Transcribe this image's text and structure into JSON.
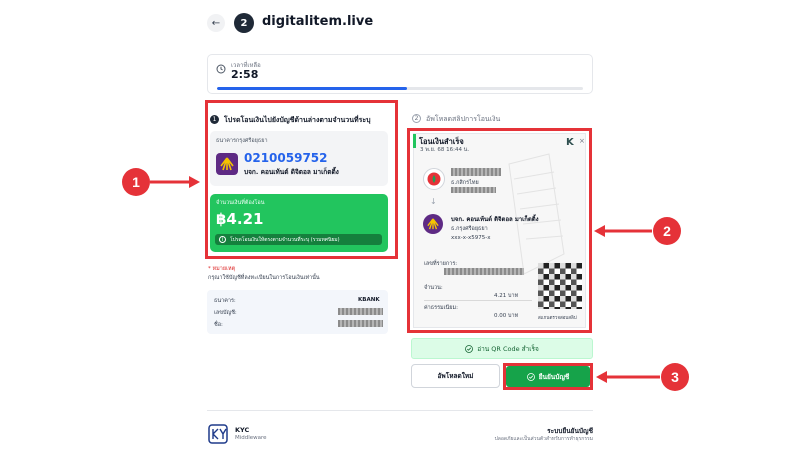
{
  "header": {
    "back_icon": "←",
    "step_number": "2",
    "site": "digitalitem.live"
  },
  "timer": {
    "label": "เวลาที่เหลือ",
    "value": "2:58",
    "progress_fraction": 0.52,
    "accent": "#2563eb"
  },
  "step1": {
    "number": "1",
    "title": "โปรดโอนเงินไปยังบัญชีด้านล่างตามจำนวนที่ระบุ",
    "bank_name": "ธนาคารกรุงศรีอยุธยา",
    "account_number": "0210059752",
    "account_name": "บจก. คอนเท้นต์ ดิจิตอล มาเก็ตติ้ง",
    "amount_label": "จำนวนเงินที่ต้องโอน",
    "amount": "฿4.21",
    "amount_note": "โปรดโอนเงินให้ตรงตามจำนวนที่ระบุ (รวมทศนิยม)",
    "remark_title": "* หมายเหตุ",
    "remark_text": "กรุณาใช้บัญชีที่ลงทะเบียนในการโอนเงินเท่านั้น"
  },
  "user_account": {
    "bank_label": "ธนาคาร:",
    "bank_value": "KBANK",
    "number_label": "เลขบัญชี:",
    "name_label": "ชื่อ:"
  },
  "step2": {
    "number": "2",
    "title": "อัพโหลดสลิปการโอนเงิน",
    "slip": {
      "title": "โอนเงินสำเร็จ",
      "date": "3 พ.ย. 68  16:44 น.",
      "brand_mark": "K",
      "close_icon": "×",
      "sender_bank": "ธ.กสิกรไทย",
      "arrow": "↓",
      "receiver_name": "บจก. คอนเท้นต์ ดิจิตอล มาเก็ตติ้ง",
      "receiver_bank": "ธ.กรุงศรีอยุธยา",
      "receiver_account": "xxx-x-x5975-x",
      "ref_label": "เลขที่รายการ:",
      "amount_label": "จำนวน:",
      "amount_value": "4.21 บาท",
      "fee_label": "ค่าธรรมเนียม:",
      "fee_value": "0.00 บาท",
      "qr_caption": "สแกนตรวจสอบสลิป"
    },
    "qr_status": "อ่าน QR Code สำเร็จ",
    "reupload_label": "อัพโหลดใหม่",
    "confirm_label": "ยืนยันบัญชี"
  },
  "callouts": [
    "1",
    "2",
    "3"
  ],
  "footer": {
    "brand": "KYC",
    "brand_sub": "Middleware",
    "title": "ระบบยืนยันบัญชี",
    "subtitle": "ปลอดภัยและเป็นส่วนตัวสำหรับการทำธุรกรรม"
  },
  "colors": {
    "callout_red": "#e53238",
    "success_green": "#22c55e",
    "confirm_green": "#16a34a",
    "accent_blue": "#2563eb"
  }
}
